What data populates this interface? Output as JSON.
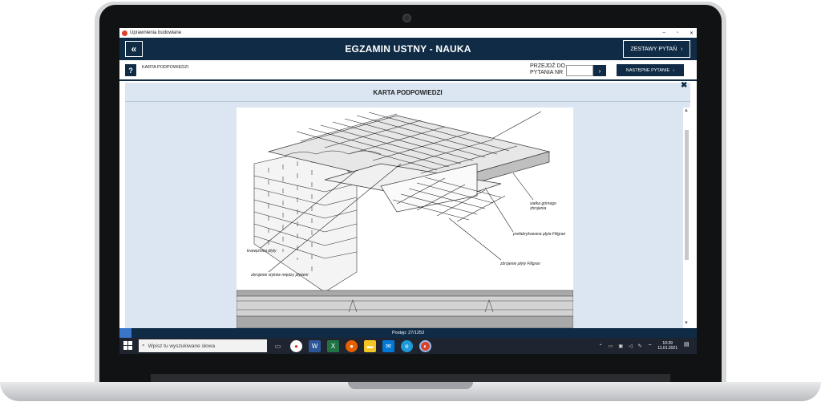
{
  "window": {
    "title": "Uprawnienia budowlane",
    "minimize": "–",
    "maximize": "▫",
    "close": "✕"
  },
  "header": {
    "back_icon": "«",
    "title": "EGZAMIN USTNY - NAUKA",
    "sets_label": "ZESTAWY PYTAŃ",
    "sets_chevron": "›"
  },
  "toolbar": {
    "hint_icon": "?",
    "hint_label": "KARTA PODPOWIEDZI",
    "goto_label": "PRZEJDŹ DO PYTANIA NR",
    "goto_value": "",
    "goto_chevron": "›",
    "next_label": "NASTĘPNE PYTANIE",
    "next_chevron": "›"
  },
  "card": {
    "close_icon": "✖",
    "title": "KARTA PODPOWIEDZI",
    "figure_labels": {
      "top_mesh": "siatka górnego zbrojenia",
      "prefab_slab": "prefabrykowana płyta Filigran",
      "edge_beam": "krawężnica płyty",
      "joint_rebar": "zbrojenie styków między płytami",
      "slab_rebar": "zbrojenie płyty Filigran"
    }
  },
  "status": {
    "progress_text": "Postęp: 27/1253",
    "progress_fraction": 0.0215
  },
  "taskbar": {
    "start_icon": "windows-icon",
    "search_placeholder": "Wpisz tu wyszukiwane słowa",
    "time": "10:39",
    "date": "11.01.2021",
    "colors": {
      "accent": "#0f2b46",
      "taskbar": "#1f2530",
      "progress": "#3a76c9"
    }
  }
}
